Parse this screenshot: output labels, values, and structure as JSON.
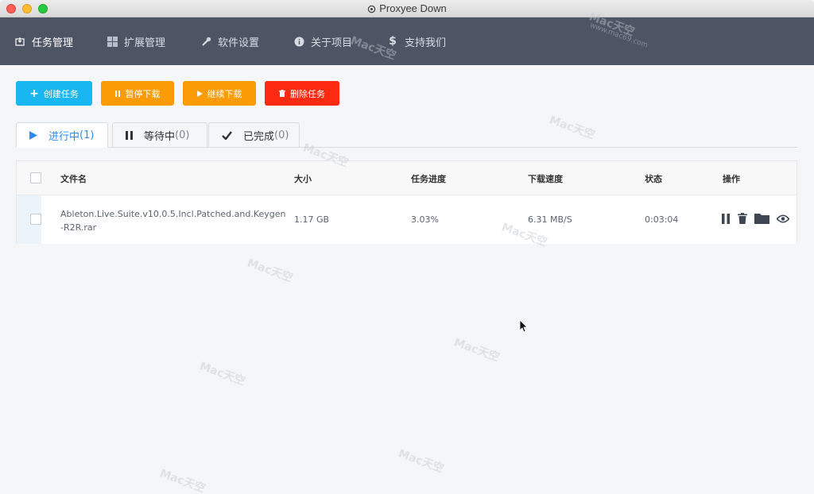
{
  "window": {
    "title": "Proxyee Down"
  },
  "nav": {
    "items": [
      {
        "label": "任务管理",
        "icon": "download-box-icon"
      },
      {
        "label": "扩展管理",
        "icon": "windows-icon"
      },
      {
        "label": "软件设置",
        "icon": "tools-icon"
      },
      {
        "label": "关于项目",
        "icon": "info-icon"
      },
      {
        "label": "支持我们",
        "icon": "dollar-icon"
      }
    ],
    "active": "任务管理"
  },
  "toolbar": {
    "create_label": "创建任务",
    "pause_label": "暂停下载",
    "resume_label": "继续下载",
    "delete_label": "删除任务"
  },
  "tabs": [
    {
      "label": "进行中",
      "count": "(1)"
    },
    {
      "label": "等待中",
      "count": "(0)"
    },
    {
      "label": "已完成",
      "count": "(0)"
    }
  ],
  "table": {
    "headers": [
      "文件名",
      "大小",
      "任务进度",
      "下载速度",
      "状态",
      "操作"
    ],
    "rows": [
      {
        "filename": "Ableton.Live.Suite.v10.0.5.Incl.Patched.and.Keygen-R2R.rar",
        "size": "1.17 GB",
        "progress": "3.03%",
        "speed": "6.31 MB/S",
        "status": "0:03:04"
      }
    ]
  },
  "watermark": {
    "brand": "Mac天空",
    "url": "www.mac69.com"
  },
  "colors": {
    "nav_bg": "#4d5565",
    "create": "#19b7f2",
    "pause": "#fb9b05",
    "delete": "#fe2b12",
    "active_tab": "#2d8cf0"
  }
}
